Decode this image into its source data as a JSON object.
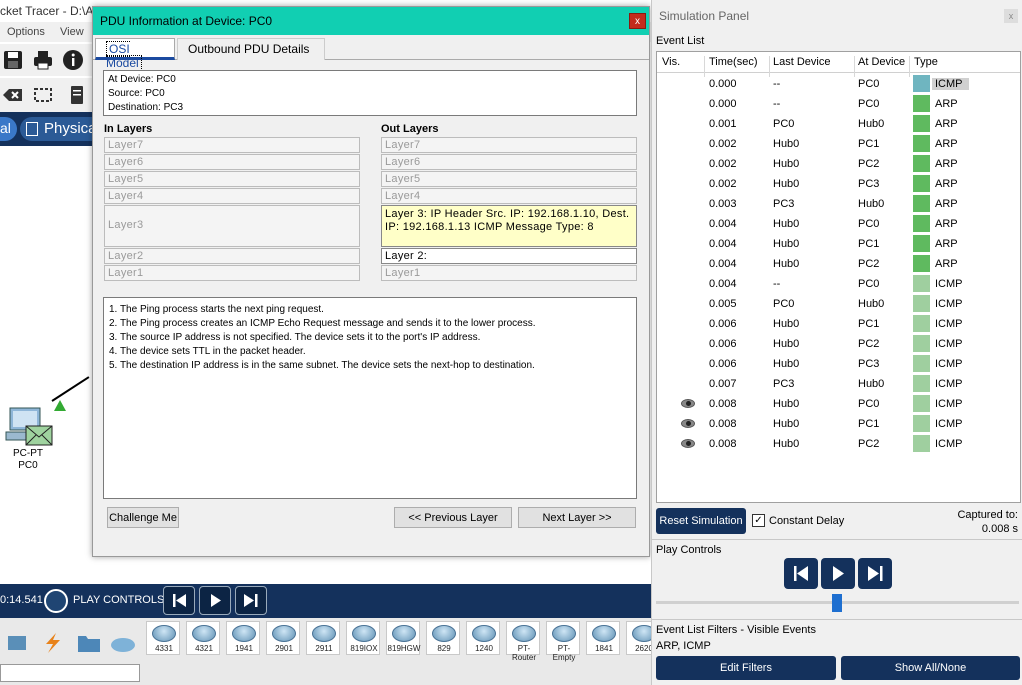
{
  "app": {
    "title_fragment": "cket Tracer - D:\\A",
    "menu": [
      "Options",
      "View"
    ],
    "mode_logical": "al",
    "mode_physical": "Physica",
    "pc_node": {
      "type": "PC-PT",
      "name": "PC0"
    },
    "sim_time": "0:14.541",
    "play_controls_label": "PLAY CONTROLS:",
    "devices": [
      "4331",
      "4321",
      "1941",
      "2901",
      "2911",
      "819IOX",
      "819HGW",
      "829",
      "1240",
      "PT-Router",
      "PT-Empty",
      "1841",
      "2620"
    ]
  },
  "pdu": {
    "title": "PDU Information at Device: PC0",
    "close": "x",
    "tabs": {
      "osi": "OSI Model",
      "outbound": "Outbound PDU Details"
    },
    "info": {
      "at_device": "At Device: PC0",
      "source": "Source: PC0",
      "destination": "Destination: PC3"
    },
    "in_layers_label": "In Layers",
    "out_layers_label": "Out Layers",
    "in_layers": [
      "Layer7",
      "Layer6",
      "Layer5",
      "Layer4",
      "Layer3",
      "Layer2",
      "Layer1"
    ],
    "out_layers": [
      "Layer7",
      "Layer6",
      "Layer5",
      "Layer4",
      "Layer 3: IP Header Src. IP: 192.168.1.10, Dest. IP: 192.168.1.13 ICMP Message Type: 8",
      "Layer 2:",
      "Layer1"
    ],
    "steps": [
      "1. The Ping process starts the next ping request.",
      "2. The Ping process creates an ICMP Echo Request message and sends it to the lower process.",
      "3. The source IP address is not specified. The device sets it to the port's IP address.",
      "4. The device sets TTL in the packet header.",
      "5. The destination IP address is in the same subnet. The device sets the next-hop to destination."
    ],
    "buttons": {
      "challenge": "Challenge Me",
      "prev": "<< Previous Layer",
      "next": "Next Layer >>"
    }
  },
  "sim_panel": {
    "title": "Simulation Panel",
    "close": "x",
    "event_list_label": "Event List",
    "columns": [
      "Vis.",
      "Time(sec)",
      "Last Device",
      "At Device",
      "Type"
    ],
    "colors": {
      "icmp_first": "#6fb5c0",
      "arp": "#5fba5f",
      "icmp": "#9fcf9f"
    },
    "events": [
      {
        "vis": "",
        "time": "0.000",
        "last": "--",
        "at": "PC0",
        "type": "ICMP",
        "color": "#6fb5c0"
      },
      {
        "vis": "",
        "time": "0.000",
        "last": "--",
        "at": "PC0",
        "type": "ARP",
        "color": "#5fba5f"
      },
      {
        "vis": "",
        "time": "0.001",
        "last": "PC0",
        "at": "Hub0",
        "type": "ARP",
        "color": "#5fba5f"
      },
      {
        "vis": "",
        "time": "0.002",
        "last": "Hub0",
        "at": "PC1",
        "type": "ARP",
        "color": "#5fba5f"
      },
      {
        "vis": "",
        "time": "0.002",
        "last": "Hub0",
        "at": "PC2",
        "type": "ARP",
        "color": "#5fba5f"
      },
      {
        "vis": "",
        "time": "0.002",
        "last": "Hub0",
        "at": "PC3",
        "type": "ARP",
        "color": "#5fba5f"
      },
      {
        "vis": "",
        "time": "0.003",
        "last": "PC3",
        "at": "Hub0",
        "type": "ARP",
        "color": "#5fba5f"
      },
      {
        "vis": "",
        "time": "0.004",
        "last": "Hub0",
        "at": "PC0",
        "type": "ARP",
        "color": "#5fba5f"
      },
      {
        "vis": "",
        "time": "0.004",
        "last": "Hub0",
        "at": "PC1",
        "type": "ARP",
        "color": "#5fba5f"
      },
      {
        "vis": "",
        "time": "0.004",
        "last": "Hub0",
        "at": "PC2",
        "type": "ARP",
        "color": "#5fba5f"
      },
      {
        "vis": "",
        "time": "0.004",
        "last": "--",
        "at": "PC0",
        "type": "ICMP",
        "color": "#9fcf9f"
      },
      {
        "vis": "",
        "time": "0.005",
        "last": "PC0",
        "at": "Hub0",
        "type": "ICMP",
        "color": "#9fcf9f"
      },
      {
        "vis": "",
        "time": "0.006",
        "last": "Hub0",
        "at": "PC1",
        "type": "ICMP",
        "color": "#9fcf9f"
      },
      {
        "vis": "",
        "time": "0.006",
        "last": "Hub0",
        "at": "PC2",
        "type": "ICMP",
        "color": "#9fcf9f"
      },
      {
        "vis": "",
        "time": "0.006",
        "last": "Hub0",
        "at": "PC3",
        "type": "ICMP",
        "color": "#9fcf9f"
      },
      {
        "vis": "",
        "time": "0.007",
        "last": "PC3",
        "at": "Hub0",
        "type": "ICMP",
        "color": "#9fcf9f"
      },
      {
        "vis": "eye",
        "time": "0.008",
        "last": "Hub0",
        "at": "PC0",
        "type": "ICMP",
        "color": "#9fcf9f"
      },
      {
        "vis": "eye",
        "time": "0.008",
        "last": "Hub0",
        "at": "PC1",
        "type": "ICMP",
        "color": "#9fcf9f"
      },
      {
        "vis": "eye",
        "time": "0.008",
        "last": "Hub0",
        "at": "PC2",
        "type": "ICMP",
        "color": "#9fcf9f"
      }
    ],
    "reset_label": "Reset Simulation",
    "constant_delay_label": "Constant Delay",
    "constant_delay_checked": true,
    "captured_label": "Captured to:",
    "captured_value": "0.008 s",
    "play_controls_label": "Play Controls",
    "filters_label": "Event List Filters - Visible Events",
    "filters_value": "ARP, ICMP",
    "edit_filters_label": "Edit Filters",
    "show_all_label": "Show All/None"
  }
}
